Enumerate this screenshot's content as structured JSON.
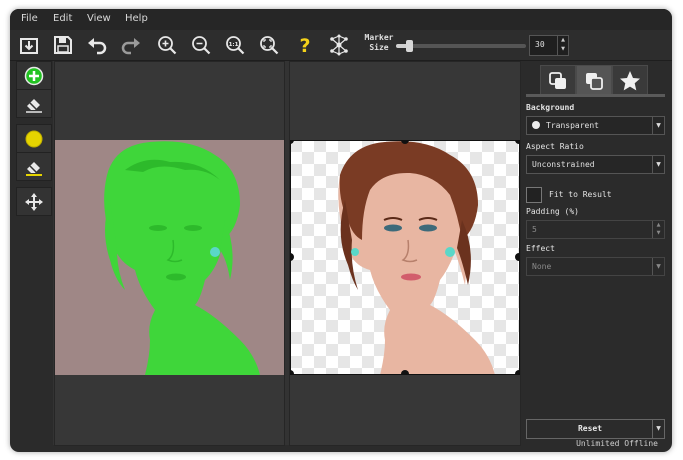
{
  "menu": [
    "File",
    "Edit",
    "View",
    "Help"
  ],
  "toolbar": {
    "marker_label_line1": "Marker",
    "marker_label_line2": "Size",
    "marker_size": "30",
    "marker_fraction": 0.1,
    "icons": [
      "save-to-file-icon",
      "save-icon",
      "undo-icon",
      "redo-icon",
      "zoom-in-icon",
      "zoom-out-icon",
      "actual-size-icon",
      "fit-to-window-icon",
      "help-icon",
      "network-icon"
    ]
  },
  "left_tools": [
    "add-marker-icon",
    "eraser-icon",
    "keep-color-marker-icon",
    "eraser-yellow-icon",
    "move-icon"
  ],
  "right_panel": {
    "tabs": [
      "background-tab-icon",
      "foreground-tab-icon",
      "star-tab-icon"
    ],
    "background_label": "Background",
    "background_value": "Transparent",
    "aspect_label": "Aspect Ratio",
    "aspect_value": "Unconstrained",
    "fit_label": "Fit to Result",
    "padding_label": "Padding (%)",
    "padding_value": "5",
    "effect_label": "Effect",
    "effect_value": "None",
    "reset_label": "Reset"
  },
  "status": "Unlimited Offline",
  "colors": {
    "window_bg": "#2b2b2b",
    "green_mask": "#3fd63a",
    "help_yellow": "#f4d21a",
    "marker_green": "#22c322",
    "marker_yellow": "#e6d400"
  }
}
